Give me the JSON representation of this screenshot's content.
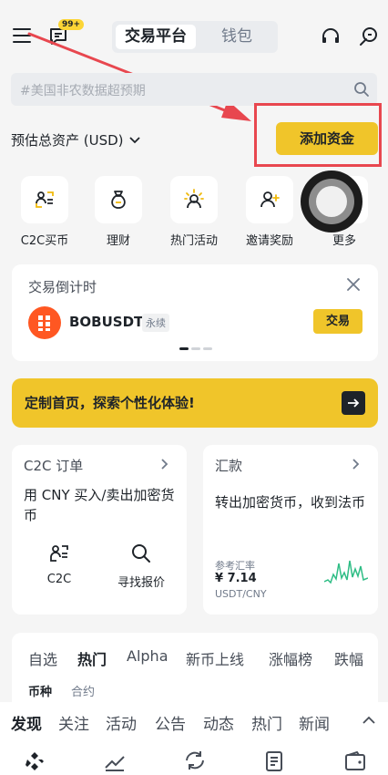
{
  "header": {
    "tabs": [
      {
        "label": "交易平台",
        "active": true
      },
      {
        "label": "钱包",
        "active": false
      }
    ],
    "notification_badge": "99+"
  },
  "search": {
    "placeholder": "#美国非农数据超预期"
  },
  "assets": {
    "label": "预估总资产 (USD)",
    "add_funds_label": "添加资金"
  },
  "shortcuts": [
    {
      "label": "C2C买币",
      "icon": "c2c-icon"
    },
    {
      "label": "理财",
      "icon": "money-bag-icon"
    },
    {
      "label": "热门活动",
      "icon": "sparkle-person-icon"
    },
    {
      "label": "邀请奖励",
      "icon": "invite-user-icon"
    },
    {
      "label": "更多",
      "icon": "more-icon"
    }
  ],
  "countdown": {
    "title": "交易倒计时",
    "symbol": "BOBUSDT",
    "tag": "永续",
    "trade_label": "交易"
  },
  "banner": {
    "text": "定制首页，探索个性化体验!"
  },
  "c2c_card": {
    "title": "C2C 订单",
    "desc": "用 CNY 买入/卖出加密货币",
    "actions": [
      {
        "label": "C2C"
      },
      {
        "label": "寻找报价"
      }
    ]
  },
  "remit_card": {
    "title": "汇款",
    "desc": "转出加密货币，收到法币",
    "rate_label": "参考汇率",
    "rate_value": "¥ 7.14",
    "pair": "USDT/CNY"
  },
  "market": {
    "tabs": [
      {
        "label": "自选"
      },
      {
        "label": "热门",
        "active": true
      },
      {
        "label": "Alpha"
      },
      {
        "label": "新币上线"
      },
      {
        "label": "涨幅榜"
      },
      {
        "label": "跌幅"
      }
    ],
    "subtabs": [
      {
        "label": "币种",
        "active": true
      },
      {
        "label": "合约"
      }
    ]
  },
  "bottom_tabs": [
    {
      "label": "发现",
      "active": true
    },
    {
      "label": "关注"
    },
    {
      "label": "活动"
    },
    {
      "label": "公告"
    },
    {
      "label": "动态"
    },
    {
      "label": "热门"
    },
    {
      "label": "新闻"
    }
  ],
  "bottom_nav_icons": [
    "home-diamond-icon",
    "markets-chart-icon",
    "trade-swap-icon",
    "futures-doc-icon",
    "wallet-icon"
  ],
  "colors": {
    "accent": "#f0c52a",
    "annotation": "#e8474f",
    "sparkline": "#2ebd85"
  }
}
